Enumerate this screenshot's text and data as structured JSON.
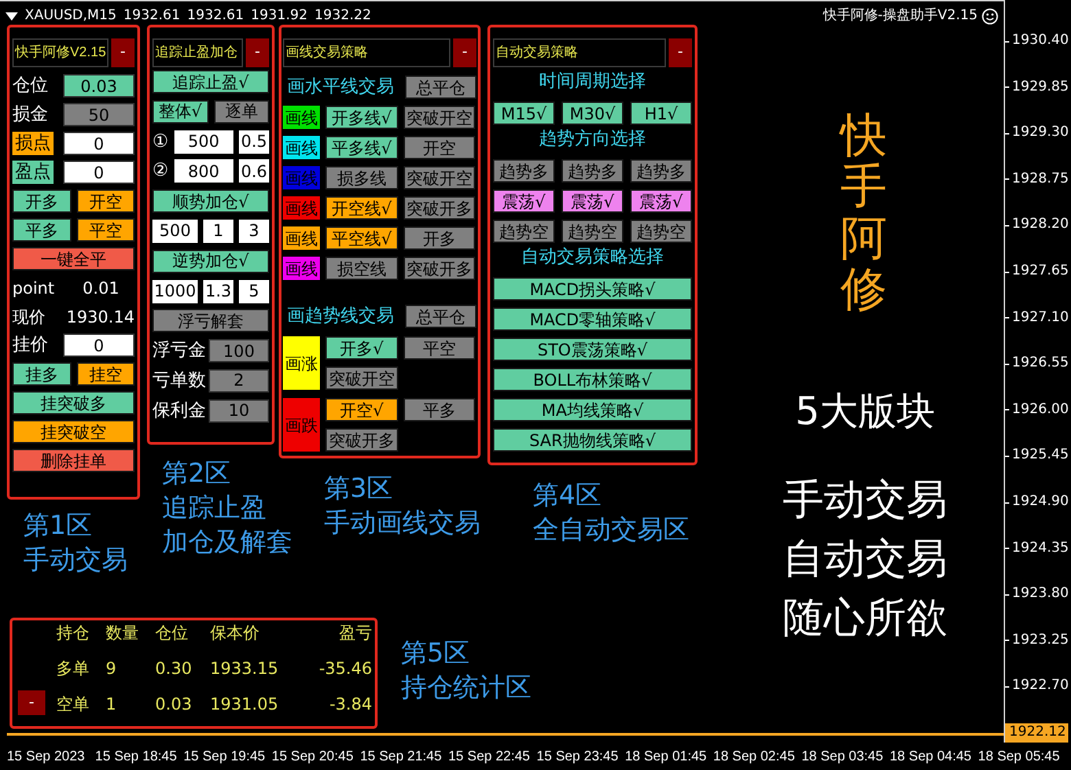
{
  "chart_header": {
    "symbol": "XAUUSD,M15",
    "prices": [
      "1932.61",
      "1932.61",
      "1931.92",
      "1932.22"
    ],
    "caption": "快手阿修-操盘助手V2.15"
  },
  "panel1": {
    "title": "快手阿修V2.15",
    "collapse": "-",
    "rows": [
      {
        "kind": "field",
        "label": {
          "text": "仓位"
        },
        "value": {
          "text": "0.03",
          "color": "#60cda0"
        }
      },
      {
        "kind": "field",
        "label": {
          "text": "损金"
        },
        "value": {
          "text": "50",
          "color": "#808080"
        }
      },
      {
        "kind": "field",
        "label": {
          "text": "损点",
          "color": "#ffa500"
        },
        "value": {
          "text": "0",
          "color": "#ffffff"
        }
      },
      {
        "kind": "field",
        "label": {
          "text": "盈点",
          "color": "#60cda0"
        },
        "value": {
          "text": "0",
          "color": "#ffffff"
        }
      },
      {
        "kind": "buttons",
        "buttons": [
          {
            "text": "开多",
            "color": "#60cda0"
          },
          {
            "text": "开空",
            "color": "#ffa500"
          }
        ]
      },
      {
        "kind": "buttons",
        "buttons": [
          {
            "text": "平多",
            "color": "#60cda0"
          },
          {
            "text": "平空",
            "color": "#ffa500"
          }
        ]
      },
      {
        "kind": "buttons",
        "buttons": [
          {
            "text": "一键全平",
            "color": "#f05a48"
          }
        ]
      },
      {
        "kind": "info",
        "label": "point",
        "value": "0.01"
      },
      {
        "kind": "info",
        "label": "现价",
        "value": "1930.14"
      },
      {
        "kind": "field",
        "label": {
          "text": "挂价"
        },
        "value": {
          "text": "0",
          "color": "#ffffff"
        }
      },
      {
        "kind": "buttons",
        "buttons": [
          {
            "text": "挂多",
            "color": "#60cda0"
          },
          {
            "text": "挂空",
            "color": "#ffa500"
          }
        ]
      },
      {
        "kind": "buttons",
        "buttons": [
          {
            "text": "挂突破多",
            "color": "#60cda0"
          }
        ]
      },
      {
        "kind": "buttons",
        "buttons": [
          {
            "text": "挂突破空",
            "color": "#ffa500"
          }
        ]
      },
      {
        "kind": "buttons",
        "buttons": [
          {
            "text": "删除挂单",
            "color": "#f05a48"
          }
        ]
      }
    ]
  },
  "panel2": {
    "title": "追踪止盈加仓",
    "collapse": "-",
    "rows": [
      {
        "kind": "buttons",
        "buttons": [
          {
            "text": "追踪止盈√",
            "color": "#60cda0"
          }
        ]
      },
      {
        "kind": "buttons",
        "buttons": [
          {
            "text": "整体√",
            "color": "#60cda0"
          },
          {
            "text": "逐单",
            "color": "#808080"
          }
        ]
      },
      {
        "kind": "inputs",
        "marker": "①",
        "values": [
          "500",
          "0.5"
        ]
      },
      {
        "kind": "inputs",
        "marker": "②",
        "values": [
          "800",
          "0.6"
        ]
      },
      {
        "kind": "buttons",
        "buttons": [
          {
            "text": "顺势加仓√",
            "color": "#60cda0"
          }
        ]
      },
      {
        "kind": "inputs",
        "values": [
          "500",
          "1",
          "3"
        ]
      },
      {
        "kind": "buttons",
        "buttons": [
          {
            "text": "逆势加仓√",
            "color": "#60cda0"
          }
        ]
      },
      {
        "kind": "inputs",
        "values": [
          "1000",
          "1.3",
          "5"
        ]
      },
      {
        "kind": "buttons",
        "buttons": [
          {
            "text": "浮亏解套",
            "color": "#808080"
          }
        ]
      },
      {
        "kind": "field",
        "label": {
          "text": "浮亏金"
        },
        "value": {
          "text": "100",
          "color": "#808080"
        }
      },
      {
        "kind": "field",
        "label": {
          "text": "亏单数"
        },
        "value": {
          "text": "2",
          "color": "#808080"
        }
      },
      {
        "kind": "field",
        "label": {
          "text": "保利金"
        },
        "value": {
          "text": "10",
          "color": "#808080"
        }
      }
    ]
  },
  "panel3": {
    "title": "画线交易策略",
    "collapse": "-",
    "horizontal": {
      "heading": "画水平线交易",
      "close_all": "总平仓",
      "lines": [
        {
          "swatch": {
            "text": "画线",
            "color": "#00e000"
          },
          "buttons": [
            {
              "text": "开多线√",
              "color": "#60cda0"
            },
            {
              "text": "突破开空",
              "color": "#808080"
            }
          ]
        },
        {
          "swatch": {
            "text": "画线",
            "color": "#00e5ee"
          },
          "buttons": [
            {
              "text": "平多线√",
              "color": "#60cda0"
            },
            {
              "text": "开空",
              "color": "#808080"
            }
          ]
        },
        {
          "swatch": {
            "text": "画线",
            "color": "#0000dd"
          },
          "buttons": [
            {
              "text": "损多线",
              "color": "#808080"
            },
            {
              "text": "突破开空",
              "color": "#808080"
            }
          ]
        },
        {
          "swatch": {
            "text": "画线",
            "color": "#ee0000"
          },
          "buttons": [
            {
              "text": "开空线√",
              "color": "#ffa500"
            },
            {
              "text": "突破开多",
              "color": "#808080"
            }
          ]
        },
        {
          "swatch": {
            "text": "画线",
            "color": "#ffa500"
          },
          "buttons": [
            {
              "text": "平空线√",
              "color": "#ffa500"
            },
            {
              "text": "开多",
              "color": "#808080"
            }
          ]
        },
        {
          "swatch": {
            "text": "画线",
            "color": "#ee00ee"
          },
          "buttons": [
            {
              "text": "损空线",
              "color": "#808080"
            },
            {
              "text": "突破开多",
              "color": "#808080"
            }
          ]
        }
      ]
    },
    "trend": {
      "heading": "画趋势线交易",
      "close_all": "总平仓",
      "groups": [
        {
          "swatch": {
            "text": "画涨",
            "color": "#ffff00"
          },
          "rows": [
            [
              {
                "text": "开多√",
                "color": "#60cda0"
              },
              {
                "text": "平空",
                "color": "#808080"
              }
            ],
            [
              {
                "text": "突破开空",
                "color": "#808080"
              }
            ]
          ]
        },
        {
          "swatch": {
            "text": "画跌",
            "color": "#ee0000"
          },
          "rows": [
            [
              {
                "text": "开空√",
                "color": "#ffa500"
              },
              {
                "text": "平多",
                "color": "#808080"
              }
            ],
            [
              {
                "text": "突破开多",
                "color": "#808080"
              }
            ]
          ]
        }
      ]
    }
  },
  "panel4": {
    "title": "自动交易策略",
    "collapse": "-",
    "sections": [
      {
        "kind": "grid",
        "heading": "时间周期选择",
        "rows": [
          [
            {
              "text": "M15√",
              "color": "#60cda0"
            },
            {
              "text": "M30√",
              "color": "#60cda0"
            },
            {
              "text": "H1√",
              "color": "#60cda0"
            }
          ]
        ]
      },
      {
        "kind": "grid",
        "heading": "趋势方向选择",
        "rows": [
          [
            {
              "text": "趋势多",
              "color": "#808080"
            },
            {
              "text": "趋势多",
              "color": "#808080"
            },
            {
              "text": "趋势多",
              "color": "#808080"
            }
          ],
          [
            {
              "text": "震荡√",
              "color": "#ee82ee"
            },
            {
              "text": "震荡√",
              "color": "#ee82ee"
            },
            {
              "text": "震荡√",
              "color": "#ee82ee"
            }
          ],
          [
            {
              "text": "趋势空",
              "color": "#808080"
            },
            {
              "text": "趋势空",
              "color": "#808080"
            },
            {
              "text": "趋势空",
              "color": "#808080"
            }
          ]
        ]
      },
      {
        "kind": "list",
        "heading": "自动交易策略选择",
        "items": [
          {
            "text": "MACD拐头策略√",
            "color": "#60cda0"
          },
          {
            "text": "MACD零轴策略√",
            "color": "#60cda0"
          },
          {
            "text": "STO震荡策略√",
            "color": "#60cda0"
          },
          {
            "text": "BOLL布林策略√",
            "color": "#60cda0"
          },
          {
            "text": "MA均线策略√",
            "color": "#60cda0"
          },
          {
            "text": "SAR抛物线策略√",
            "color": "#60cda0"
          }
        ]
      }
    ]
  },
  "panel5": {
    "collapse": "-",
    "columns": [
      "持仓",
      "数量",
      "仓位",
      "保本价",
      "盈亏"
    ],
    "rows": [
      [
        "多单",
        "9",
        "0.30",
        "1933.15",
        "-35.46"
      ],
      [
        "空单",
        "1",
        "0.03",
        "1931.05",
        "-3.84"
      ]
    ]
  },
  "zones": [
    {
      "lines": [
        "第1区",
        "手动交易"
      ]
    },
    {
      "lines": [
        "第2区",
        "追踪止盈",
        "加仓及解套"
      ]
    },
    {
      "lines": [
        "第3区",
        "手动画线交易"
      ]
    },
    {
      "lines": [
        "第4区",
        "全自动交易区"
      ]
    },
    {
      "lines": [
        "第5区",
        "持仓统计区"
      ]
    }
  ],
  "vertical_title": "快手阿修",
  "blocks_title": "5大版块",
  "slogan": [
    "手动交易",
    "自动交易",
    "随心所欲"
  ],
  "price_axis": {
    "ticks": [
      "1930.40",
      "1929.85",
      "1929.30",
      "1928.75",
      "1928.20",
      "1927.65",
      "1927.10",
      "1926.55",
      "1926.00",
      "1925.45",
      "1924.90",
      "1924.35",
      "1923.80",
      "1923.25",
      "1922.70"
    ],
    "current": "1922.12"
  },
  "time_axis": [
    "15 Sep 2023",
    "15 Sep 18:45",
    "15 Sep 19:45",
    "15 Sep 20:45",
    "15 Sep 21:45",
    "15 Sep 22:45",
    "15 Sep 23:45",
    "18 Sep 01:45",
    "18 Sep 02:45",
    "18 Sep 03:45",
    "18 Sep 04:45",
    "18 Sep 05:45"
  ]
}
